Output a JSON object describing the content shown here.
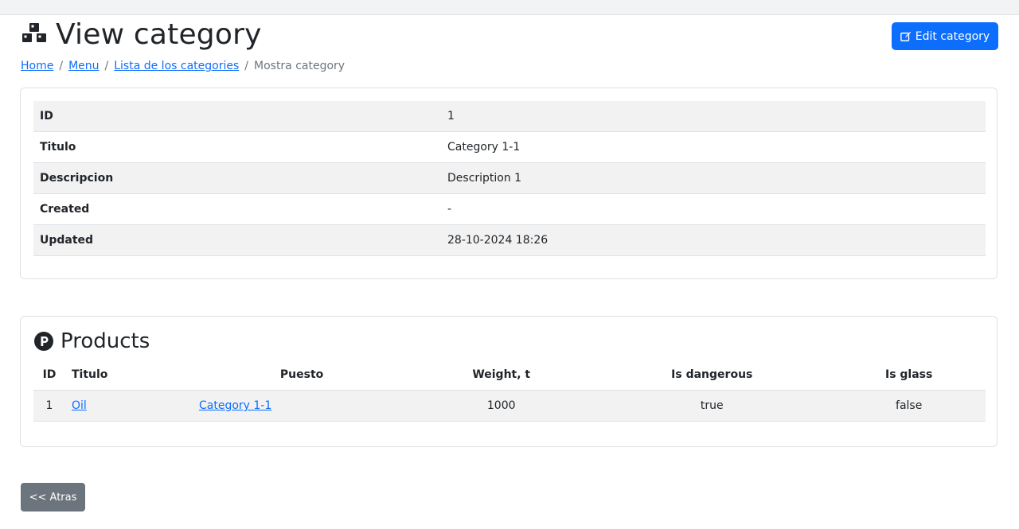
{
  "header": {
    "title": "View category",
    "title_icon": "cubes-icon",
    "edit_button_label": "Edit category",
    "edit_icon": "edit-icon"
  },
  "breadcrumb": {
    "items": [
      "Home",
      "Menu",
      "Lista de los categories"
    ],
    "separator": "/",
    "current": "Mostra category"
  },
  "details": {
    "rows": [
      {
        "label": "ID",
        "value": "1"
      },
      {
        "label": "Titulo",
        "value": "Category 1-1"
      },
      {
        "label": "Descripcion",
        "value": "Description 1"
      },
      {
        "label": "Created",
        "value": "-"
      },
      {
        "label": "Updated",
        "value": "28-10-2024 18:26"
      }
    ]
  },
  "products": {
    "title": "Products",
    "icon": "product-p-icon",
    "columns": [
      "ID",
      "Titulo",
      "Puesto",
      "Weight, t",
      "Is dangerous",
      "Is glass"
    ],
    "rows": [
      {
        "id": "1",
        "title": "Oil",
        "puesto": "Category 1-1",
        "weight": "1000",
        "dangerous": "true",
        "glass": "false"
      }
    ]
  },
  "footer": {
    "back_label": "<< Atras"
  },
  "colors": {
    "primary": "#0d6efd",
    "secondary": "#6c757d",
    "stripe": "#f2f2f2"
  }
}
